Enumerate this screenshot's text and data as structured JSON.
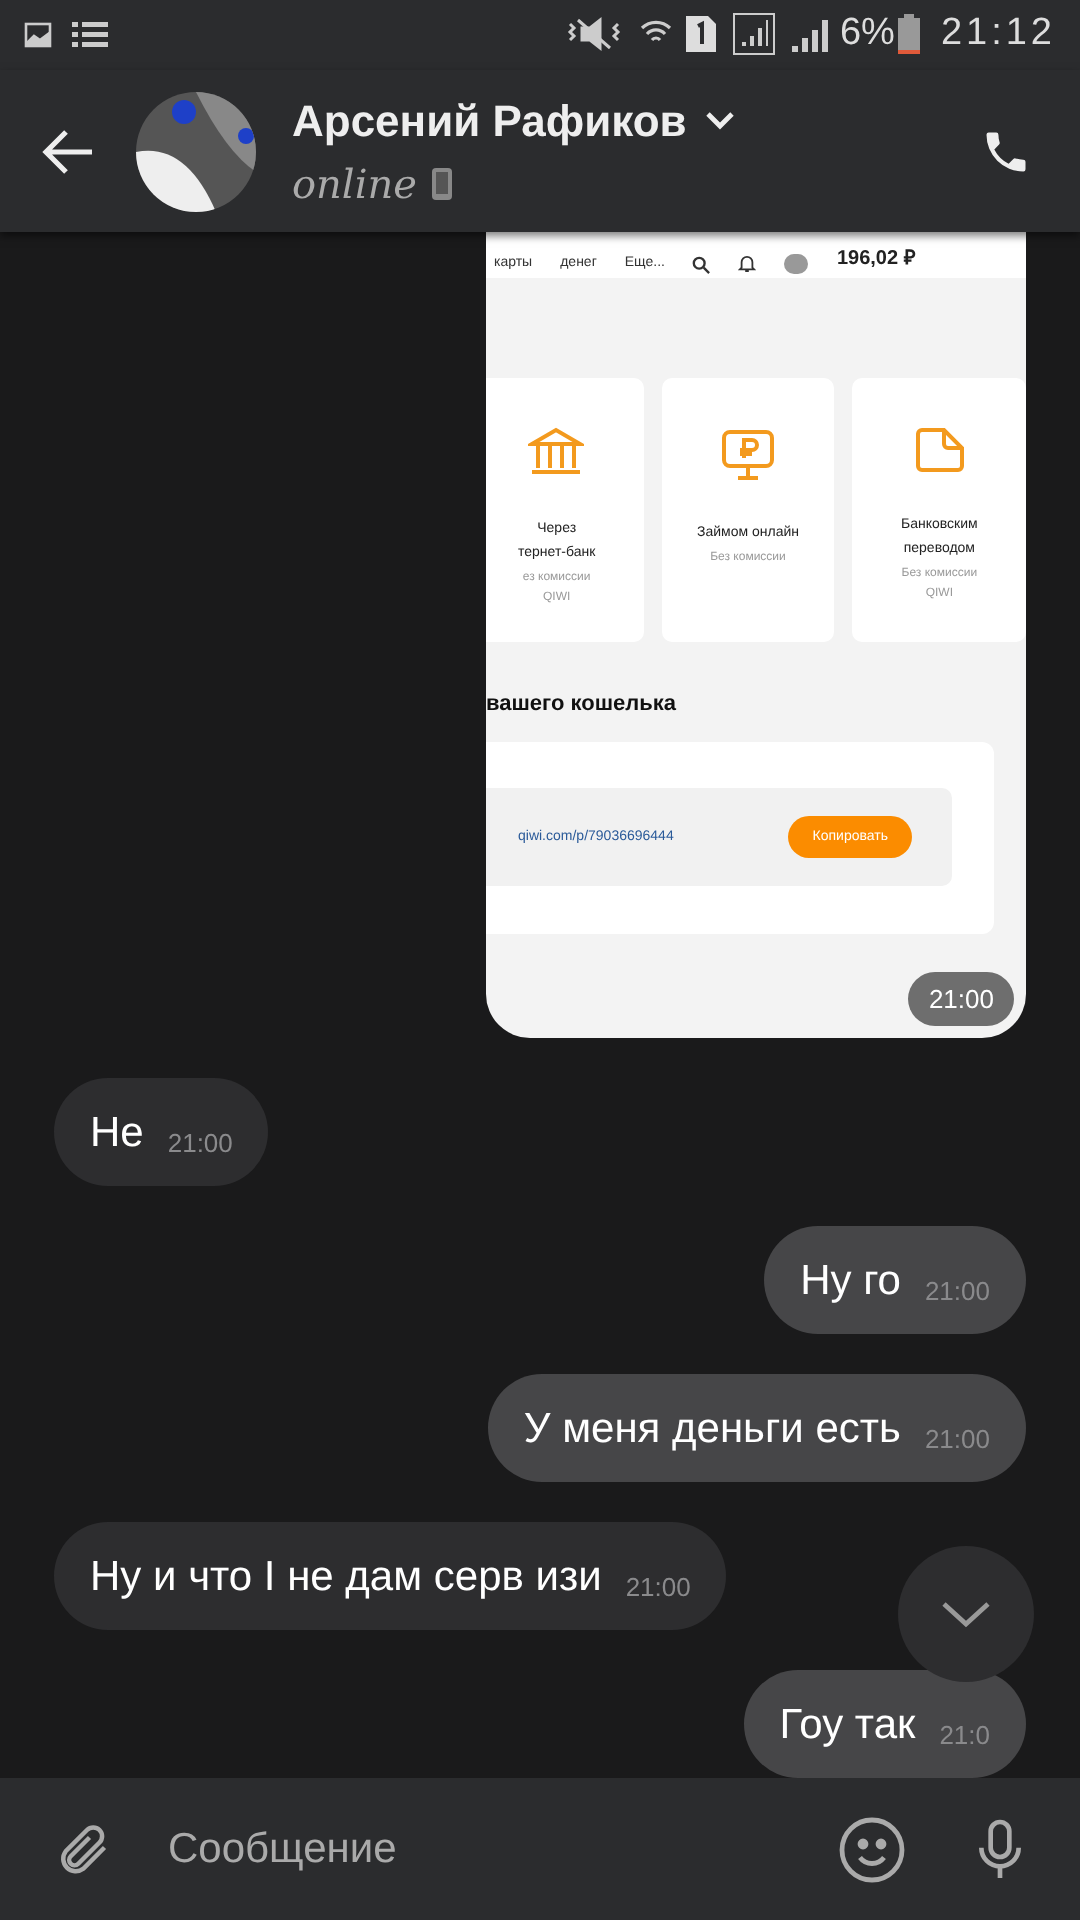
{
  "status_bar": {
    "battery": "6%",
    "time": "21:12"
  },
  "header": {
    "name": "Арсений Рафиков",
    "status": "online"
  },
  "messages": [
    {
      "kind": "image",
      "outgoing": true,
      "time": "21:00",
      "screenshot": {
        "nav": [
          "карты",
          "денег",
          "Еще..."
        ],
        "balance": "196,02 ₽",
        "cards": [
          {
            "title": "Через",
            "title_2": "тернет-банк",
            "note": "ез комиссии",
            "note_2": "QIWI"
          },
          {
            "title": "Займом онлайн",
            "note": "Без комиссии"
          },
          {
            "title": "Банковским",
            "title_2": "переводом",
            "note": "Без комиссии",
            "note_2": "QIWI"
          }
        ],
        "section": "вашего кошелька",
        "link": "qiwi.com/p/79036696444",
        "button": "Копировать"
      }
    },
    {
      "kind": "text",
      "outgoing": false,
      "text": "Не",
      "time": "21:00"
    },
    {
      "kind": "text",
      "outgoing": true,
      "text": "Ну го",
      "time": "21:00"
    },
    {
      "kind": "text",
      "outgoing": true,
      "text": "У меня деньги есть",
      "time": "21:00"
    },
    {
      "kind": "text",
      "outgoing": false,
      "text": "Ну и что I не дам серв изи",
      "time": "21:00"
    },
    {
      "kind": "text",
      "outgoing": true,
      "text": "Гоу так",
      "time": "21:0"
    }
  ],
  "composer": {
    "placeholder": "Сообщение"
  }
}
